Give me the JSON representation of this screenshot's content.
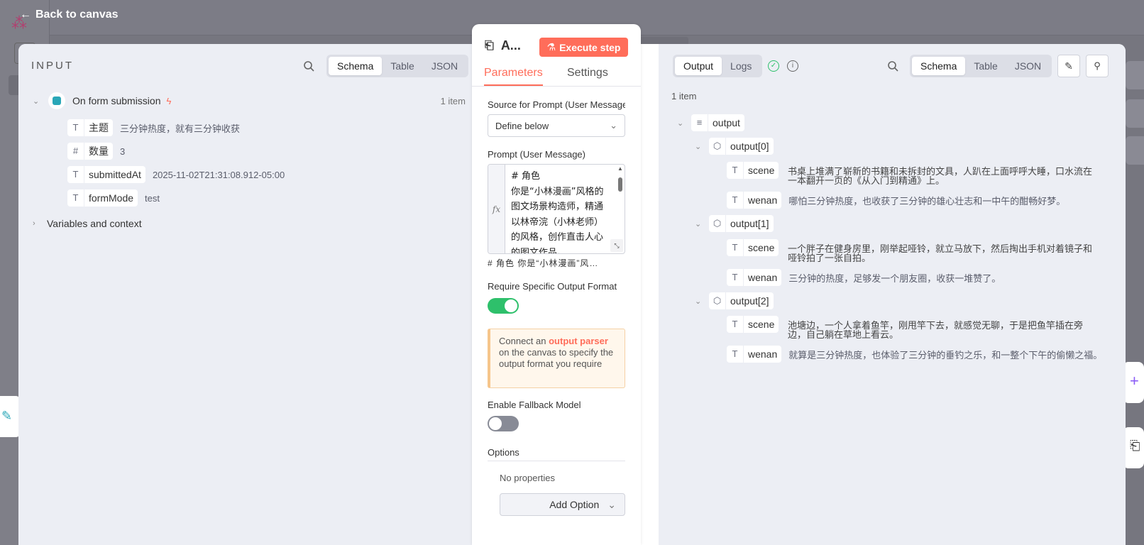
{
  "back_link": {
    "label": "Back to canvas"
  },
  "input": {
    "title": "INPUT",
    "view_tabs": [
      "Schema",
      "Table",
      "JSON"
    ],
    "active_tab": "Schema",
    "node": {
      "name": "On form submission",
      "count": "1 item"
    },
    "fields": [
      {
        "type_icon": "T",
        "key": "主题",
        "value": "三分钟热度，就有三分钟收获"
      },
      {
        "type_icon": "#",
        "key": "数量",
        "value": "3"
      },
      {
        "type_icon": "T",
        "key": "submittedAt",
        "value": "2025-11-02T21:31:08.912-05:00"
      },
      {
        "type_icon": "T",
        "key": "formMode",
        "value": "test"
      }
    ],
    "variables_label": "Variables and context"
  },
  "editor": {
    "node_title": "A...",
    "execute_label": "Execute step",
    "tabs": [
      "Parameters",
      "Settings"
    ],
    "source_label": "Source for Prompt (User Message)",
    "source_value": "Define below",
    "prompt_label": "Prompt (User Message)",
    "prompt_text": "# 角色\n你是“小林漫画”风格的图文场景构造师，精通以林帝浣（小林老师）的风格，创作直击人心的图文作品。",
    "prompt_preview": "# 角色 你是“小林漫画”风…",
    "output_format_label": "Require Specific Output Format",
    "output_format_on": true,
    "notice": {
      "prefix": "Connect an ",
      "link": "output parser",
      "suffix": " on the canvas to specify the output format you require"
    },
    "fallback_label": "Enable Fallback Model",
    "fallback_on": false,
    "options_label": "Options",
    "no_properties": "No properties",
    "add_option_label": "Add Option"
  },
  "output": {
    "tabs": [
      "Output",
      "Logs"
    ],
    "active_tab": "Output",
    "view_tabs": [
      "Schema",
      "Table",
      "JSON"
    ],
    "active_view": "Schema",
    "count": "1 item",
    "root": "output",
    "items": [
      {
        "name": "output[0]",
        "scene": "书桌上堆满了崭新的书籍和未拆封的文具，人趴在上面呼呼大睡，口水流在一本翻开一页的《从入门到精通》上。",
        "wenan": "哪怕三分钟热度，也收获了三分钟的雄心壮志和一中午的酣畅好梦。"
      },
      {
        "name": "output[1]",
        "scene": "一个胖子在健身房里，刚举起哑铃，就立马放下，然后掏出手机对着镜子和哑铃拍了一张自拍。",
        "wenan": "三分钟的热度，足够发一个朋友圈，收获一堆赞了。"
      },
      {
        "name": "output[2]",
        "scene": "池塘边，一个人拿着鱼竿，刚甩竿下去，就感觉无聊，于是把鱼竿插在旁边，自己躺在草地上看云。",
        "wenan": "就算是三分钟热度，也体验了三分钟的垂钓之乐，和一整个下午的偷懒之福。"
      }
    ],
    "scene_key": "scene",
    "wenan_key": "wenan"
  },
  "colors": {
    "accent": "#ff6d5a",
    "toggle_on": "#2ec06b",
    "node_icon": "#2aa7b8"
  }
}
